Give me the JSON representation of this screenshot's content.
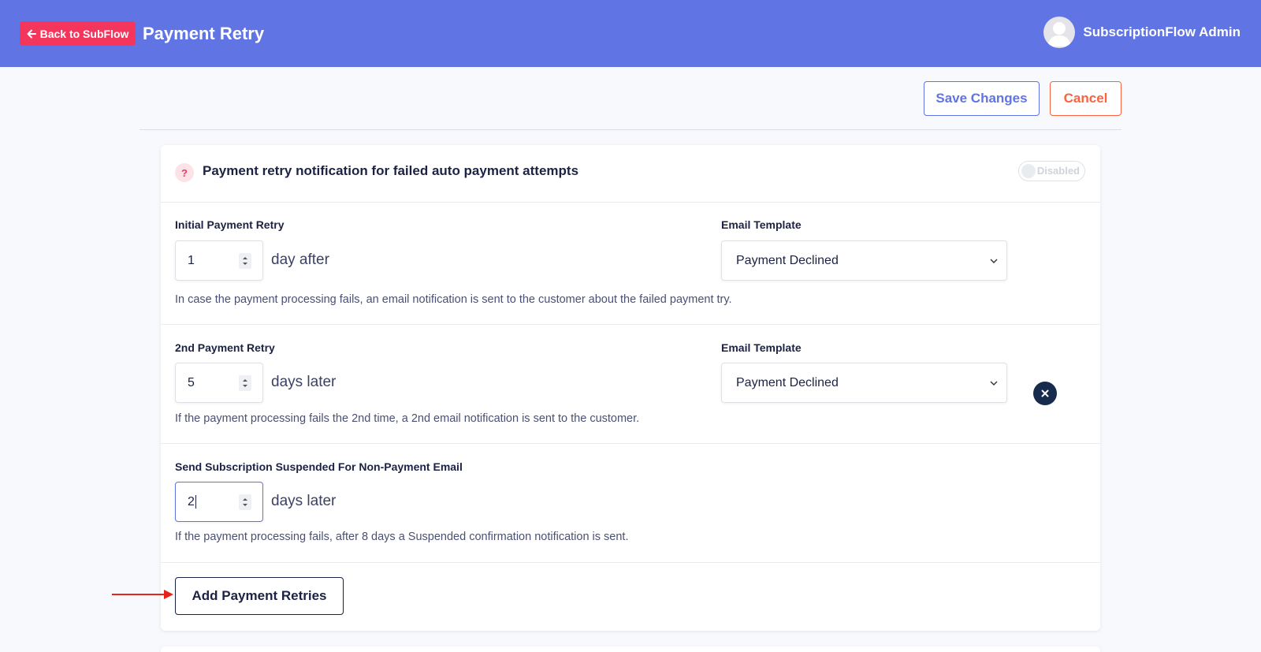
{
  "header": {
    "back_label": "Back to SubFlow",
    "title": "Payment Retry",
    "user_name": "SubscriptionFlow Admin"
  },
  "actions": {
    "save_label": "Save Changes",
    "cancel_label": "Cancel"
  },
  "card": {
    "help_glyph": "?",
    "title": "Payment retry notification for failed auto payment attempts",
    "toggle_label": "Disabled"
  },
  "retries": [
    {
      "label": "Initial Payment Retry",
      "value": "1",
      "unit": "day after",
      "email_label": "Email Template",
      "email_template": "Payment Declined",
      "help": "In case the payment processing fails, an email notification is sent to the customer about the failed payment try."
    },
    {
      "label": "2nd Payment Retry",
      "value": "5",
      "unit": "days later",
      "email_label": "Email Template",
      "email_template": "Payment Declined",
      "help": "If the payment processing fails the 2nd time, a 2nd email notification is sent to the customer."
    }
  ],
  "suspended": {
    "label": "Send Subscription Suspended For Non-Payment Email",
    "value": "2",
    "unit": "days later",
    "help": "If the payment processing fails, after 8 days a Suspended confirmation notification is sent."
  },
  "add_button_label": "Add Payment Retries",
  "colors": {
    "header_bg": "#6074e4",
    "back_button": "#f5365c",
    "cancel": "#fb6340",
    "annotation_arrow": "#e8231a"
  },
  "icons": {
    "back": "arrow-left-icon",
    "avatar": "user-avatar-icon",
    "help": "question-icon",
    "remove": "close-icon",
    "select": "chevron-down-icon",
    "spinner": "spinner-arrows-icon"
  }
}
